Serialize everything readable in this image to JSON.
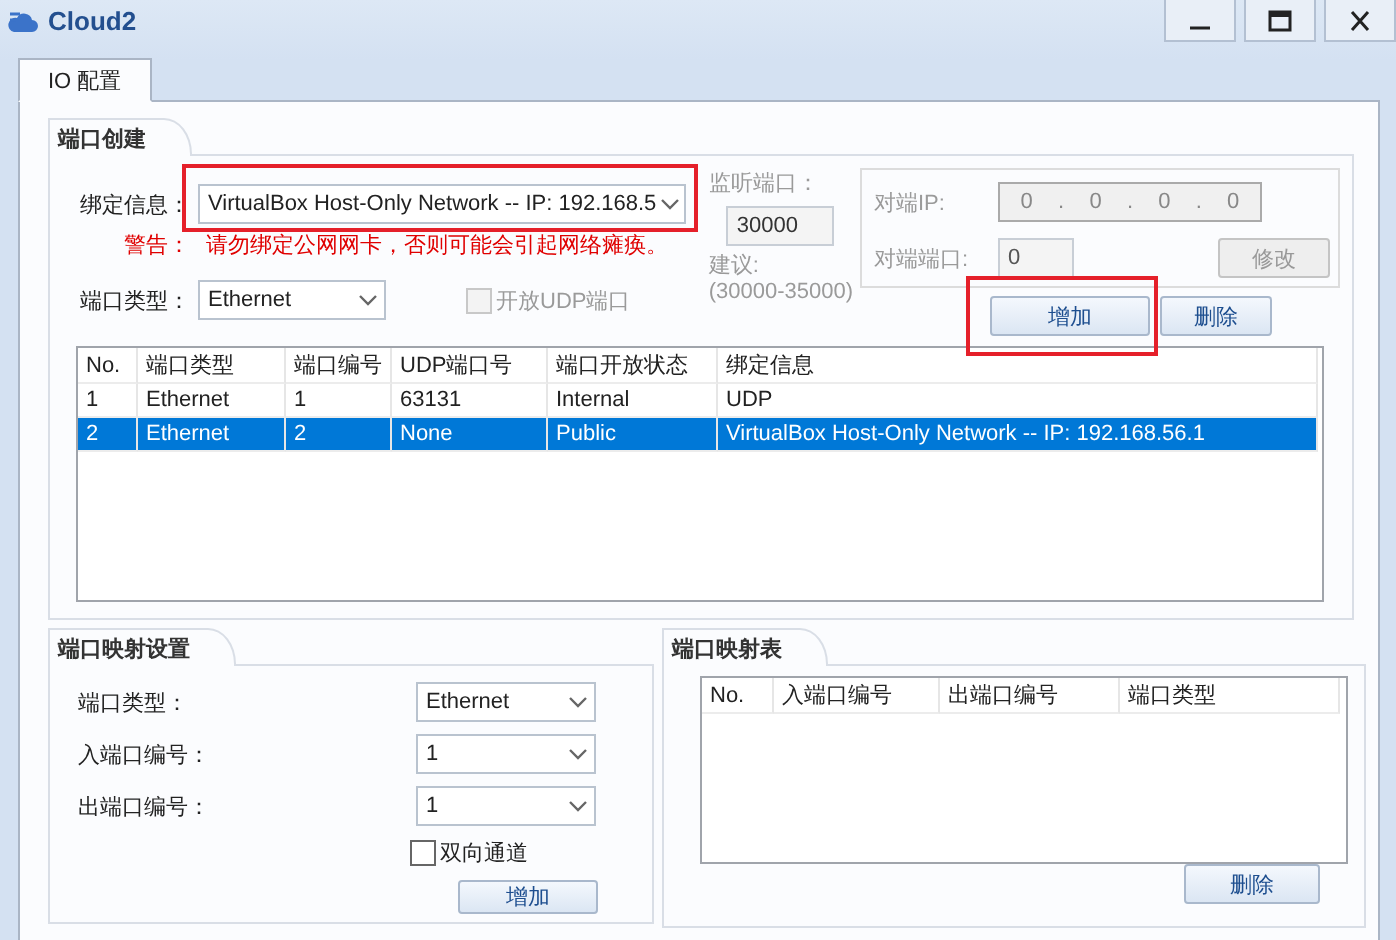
{
  "window": {
    "title": "Cloud2"
  },
  "tabs": [
    {
      "label": "IO 配置",
      "selected": true
    }
  ],
  "port_creation": {
    "title": "端口创建",
    "binding": {
      "label": "绑定信息：",
      "value": "VirtualBox Host-Only Network -- IP: 192.168.5",
      "highlighted": true
    },
    "warning": {
      "label": "警告：",
      "text": "请勿绑定公网网卡，否则可能会引起网络瘫痪。"
    },
    "port_type": {
      "label": "端口类型：",
      "value": "Ethernet"
    },
    "udp_checkbox": {
      "label": "开放UDP端口",
      "checked": false,
      "disabled": true
    },
    "listen_port": {
      "label": "监听端口：",
      "value": "30000",
      "suggestion_label": "建议:",
      "suggestion_range": "(30000-35000)",
      "disabled": true
    },
    "peer": {
      "ip_label": "对端IP:",
      "ip_octets": [
        "0",
        "0",
        "0",
        "0"
      ],
      "ip_separators": [
        ".",
        ".",
        "."
      ],
      "port_label": "对端端口:",
      "port_value": "0",
      "modify_button": "修改",
      "disabled": true
    },
    "buttons": [
      {
        "label": "增加",
        "highlighted": true
      },
      {
        "label": "删除",
        "highlighted": false
      }
    ],
    "table": {
      "columns": [
        "No.",
        "端口类型",
        "端口编号",
        "UDP端口号",
        "端口开放状态",
        "绑定信息"
      ],
      "rows": [
        {
          "cells": [
            "1",
            "Ethernet",
            "1",
            "63131",
            "Internal",
            "UDP"
          ],
          "selected": false
        },
        {
          "cells": [
            "2",
            "Ethernet",
            "2",
            "None",
            "Public",
            "VirtualBox Host-Only Network -- IP: 192.168.56.1"
          ],
          "selected": true
        }
      ]
    }
  },
  "mapping_settings": {
    "title": "端口映射设置",
    "fields": [
      {
        "label": "端口类型：",
        "value": "Ethernet"
      },
      {
        "label": "入端口编号：",
        "value": "1"
      },
      {
        "label": "出端口编号：",
        "value": "1"
      }
    ],
    "bidirectional": {
      "label": "双向通道",
      "checked": false
    },
    "add_button": "增加"
  },
  "mapping_table": {
    "title": "端口映射表",
    "columns": [
      "No.",
      "入端口编号",
      "出端口编号",
      "端口类型"
    ],
    "delete_button": "删除"
  }
}
